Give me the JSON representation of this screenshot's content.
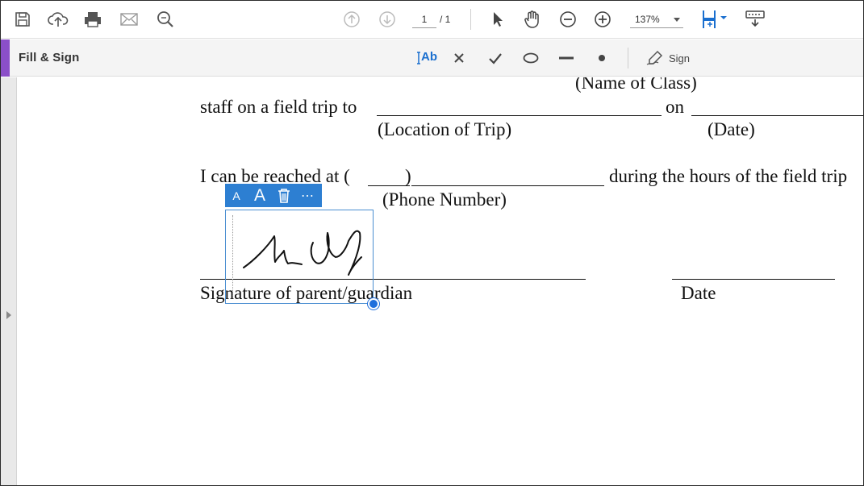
{
  "toolbar": {
    "icons": [
      "save-icon",
      "upload-icon",
      "print-icon",
      "email-icon",
      "search-zoom-icon",
      "previous-page-icon",
      "next-page-icon",
      "select-pointer-icon",
      "hand-tool-icon",
      "zoom-out-icon",
      "zoom-in-icon",
      "page-display-icon",
      "keyboard-icon"
    ],
    "page_current": "1",
    "page_total": "/ 1",
    "zoom": "137%",
    "accent_color": "#1a6fcf"
  },
  "fill_sign": {
    "title": "Fill & Sign",
    "text_tool_label": "Ab",
    "sign_label": "Sign",
    "accent_color": "#8b4fc8"
  },
  "document": {
    "name_of_class": "(Name of Class)",
    "field_trip_text": "staff on a field trip to",
    "on_text": "on",
    "location_of_trip": "(Location of Trip)",
    "date_caption": "(Date)",
    "reach_prefix": "I can be reached at (",
    "reach_paren": ")",
    "reach_suffix": "during the hours of the field trip",
    "phone_number": "(Phone Number)",
    "signature_label": "Signature of parent/guardian",
    "date_label": "Date"
  },
  "signature_widget": {
    "small_a": "A",
    "large_a": "A",
    "more": "⋯",
    "icons": [
      "decrease-size-icon",
      "increase-size-icon",
      "trash-icon",
      "more-options-icon"
    ],
    "color": "#2d7fd2"
  }
}
